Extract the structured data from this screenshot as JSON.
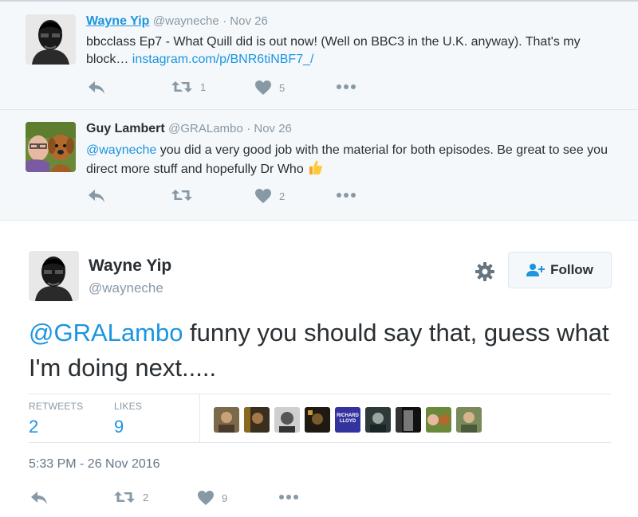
{
  "tweets": [
    {
      "name": "Wayne Yip",
      "handle": "@wayneche",
      "date": "· Nov 26",
      "text_before": "bbcclass Ep7 - What Quill did is out now! (Well on BBC3 in the U.K. anyway). That's my block… ",
      "link": "instagram.com/p/BNR6tiNBF7_/",
      "retweets": "1",
      "likes": "5"
    },
    {
      "name": "Guy Lambert",
      "handle": "@GRALambo",
      "date": "· Nov 26",
      "mention": "@wayneche",
      "text_after": " you did a very good job with the material for both episodes. Be great to see you direct more stuff and hopefully Dr Who",
      "retweets": "",
      "likes": "2"
    }
  ],
  "main": {
    "name": "Wayne Yip",
    "handle": "@wayneche",
    "follow_label": "Follow",
    "mention": "@GRALambo",
    "text": " funny you should say that, guess what I'm doing next.....",
    "retweets_label": "RETWEETS",
    "retweets": "2",
    "likes_label": "LIKES",
    "likes": "9",
    "liker_overlay_text": "RICHARD\nLLOYD",
    "timestamp": "5:33 PM - 26 Nov 2016",
    "action_retweets": "2",
    "action_likes": "9"
  },
  "colors": {
    "link": "#1b95e0",
    "muted": "#8899a6",
    "text": "#292f33",
    "bg_reply": "#f5f8fa"
  },
  "icons": [
    "reply-icon",
    "retweet-icon",
    "heart-icon",
    "more-icon",
    "gear-icon",
    "follow-person-icon",
    "thumbs-up-emoji"
  ]
}
